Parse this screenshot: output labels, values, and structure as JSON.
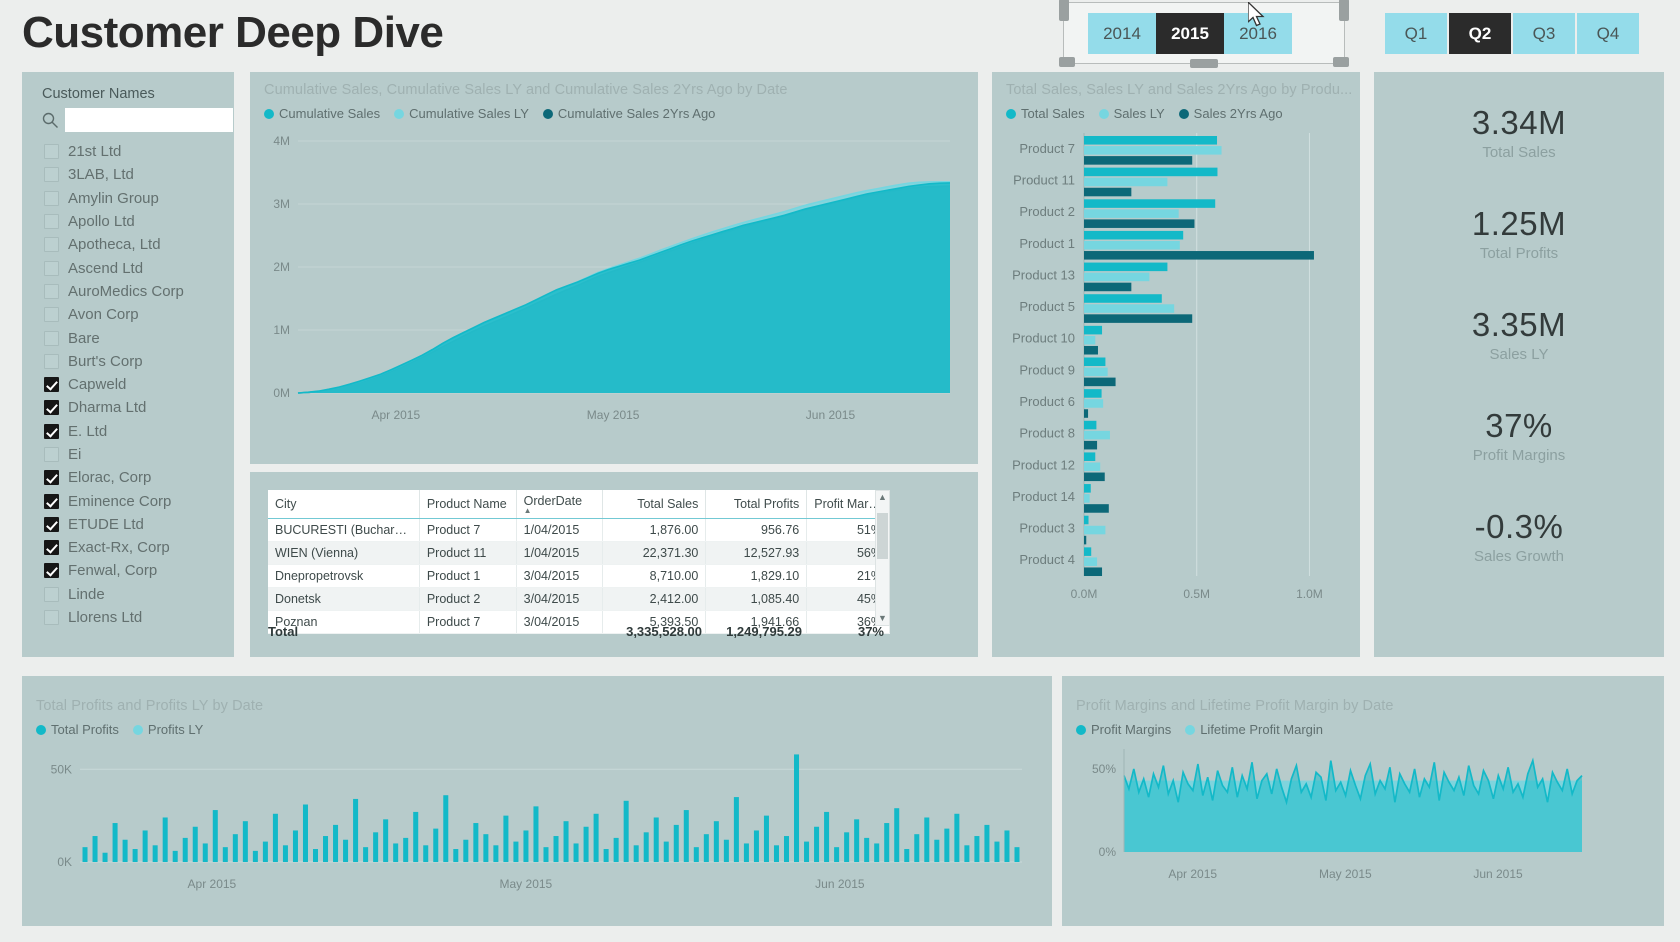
{
  "header": {
    "title": "Customer Deep Dive",
    "year_slicer": {
      "name": "year-slicer",
      "options": [
        "2014",
        "2015",
        "2016"
      ],
      "selected": "2015"
    },
    "quarter_slicer": {
      "name": "quarter-slicer",
      "options": [
        "Q1",
        "Q2",
        "Q3",
        "Q4"
      ],
      "selected": "Q2"
    }
  },
  "slicer": {
    "heading": "Customer Names",
    "search_placeholder": "",
    "search_value": "",
    "search_icon": "search-icon",
    "items": [
      {
        "label": "21st Ltd",
        "checked": false
      },
      {
        "label": "3LAB, Ltd",
        "checked": false
      },
      {
        "label": "Amylin Group",
        "checked": false
      },
      {
        "label": "Apollo Ltd",
        "checked": false
      },
      {
        "label": "Apotheca, Ltd",
        "checked": false
      },
      {
        "label": "Ascend Ltd",
        "checked": false
      },
      {
        "label": "AuroMedics Corp",
        "checked": false
      },
      {
        "label": "Avon Corp",
        "checked": false
      },
      {
        "label": "Bare",
        "checked": false
      },
      {
        "label": "Burt's Corp",
        "checked": false
      },
      {
        "label": "Capweld",
        "checked": true
      },
      {
        "label": "Dharma Ltd",
        "checked": true
      },
      {
        "label": "E. Ltd",
        "checked": true
      },
      {
        "label": "Ei",
        "checked": false
      },
      {
        "label": "Elorac, Corp",
        "checked": true
      },
      {
        "label": "Eminence Corp",
        "checked": true
      },
      {
        "label": "ETUDE Ltd",
        "checked": true
      },
      {
        "label": "Exact-Rx, Corp",
        "checked": true
      },
      {
        "label": "Fenwal, Corp",
        "checked": true
      },
      {
        "label": "Linde",
        "checked": false
      },
      {
        "label": "Llorens Ltd",
        "checked": false
      }
    ]
  },
  "kpis": [
    {
      "value": "3.34M",
      "label": "Total Sales"
    },
    {
      "value": "1.25M",
      "label": "Total Profits"
    },
    {
      "value": "3.35M",
      "label": "Sales LY"
    },
    {
      "value": "37%",
      "label": "Profit Margins"
    },
    {
      "value": "-0.3%",
      "label": "Sales Growth"
    }
  ],
  "table": {
    "columns": [
      "City",
      "Product Name",
      "OrderDate",
      "Total Sales",
      "Total Profits",
      "Profit Margins"
    ],
    "sorted_column": "OrderDate",
    "sort_direction": "asc",
    "rows": [
      [
        "BUCURESTI (Bucharest)",
        "Product 7",
        "1/04/2015",
        "1,876.00",
        "956.76",
        "51%"
      ],
      [
        "WIEN (Vienna)",
        "Product 11",
        "1/04/2015",
        "22,371.30",
        "12,527.93",
        "56%"
      ],
      [
        "Dnepropetrovsk",
        "Product 1",
        "3/04/2015",
        "8,710.00",
        "1,829.10",
        "21%"
      ],
      [
        "Donetsk",
        "Product 2",
        "3/04/2015",
        "2,412.00",
        "1,085.40",
        "45%"
      ],
      [
        "Poznan",
        "Product 7",
        "3/04/2015",
        "5,393.50",
        "1,941.66",
        "36%"
      ]
    ],
    "total_row": {
      "label": "Total",
      "total_sales": "3,335,528.00",
      "total_profits": "1,249,795.29",
      "profit_margins": "37%"
    }
  },
  "colors": {
    "series_primary": "#13b9c8",
    "series_ly": "#76d6e0",
    "series_2yrs": "#0c6878",
    "panel_bg": "#b7cbcb",
    "page_bg": "#eceeed",
    "chip": "#94dcea",
    "chip_selected": "#2b2b2b"
  },
  "chart_data": [
    {
      "name": "cumulative-sales-area-chart",
      "type": "area",
      "title": "Cumulative Sales, Cumulative Sales LY and Cumulative Sales 2Yrs Ago by Date",
      "xlabel": "",
      "ylabel": "",
      "ylim": [
        0,
        4000000
      ],
      "ytick_labels": [
        "0M",
        "1M",
        "2M",
        "3M",
        "4M"
      ],
      "ytick_values": [
        0,
        1000000,
        2000000,
        3000000,
        4000000
      ],
      "xtick_labels": [
        "Apr 2015",
        "May 2015",
        "Jun 2015"
      ],
      "grid": true,
      "legend": [
        "Cumulative Sales",
        "Cumulative Sales LY",
        "Cumulative Sales 2Yrs Ago"
      ],
      "legend_position": "top",
      "x": [
        0,
        1,
        2,
        3,
        4,
        5,
        6,
        7,
        8,
        9,
        10,
        11,
        12,
        13,
        14,
        15,
        16,
        17,
        18,
        19,
        20,
        21,
        22,
        23,
        24,
        25,
        26,
        27,
        28,
        29,
        30,
        31,
        32,
        33,
        34,
        35,
        36,
        37,
        38,
        39,
        40,
        41,
        42,
        43,
        44,
        45,
        46,
        47,
        48,
        49,
        50,
        51,
        52,
        53,
        54,
        55,
        56,
        57,
        58,
        59,
        60,
        61,
        62,
        63
      ],
      "series": [
        {
          "name": "Cumulative Sales",
          "color": "#13b9c8",
          "values": [
            0,
            12000,
            30000,
            60000,
            95000,
            140000,
            190000,
            245000,
            300000,
            370000,
            445000,
            520000,
            600000,
            690000,
            790000,
            880000,
            960000,
            1040000,
            1120000,
            1190000,
            1260000,
            1330000,
            1400000,
            1480000,
            1560000,
            1640000,
            1700000,
            1760000,
            1830000,
            1900000,
            1960000,
            2010000,
            2060000,
            2110000,
            2170000,
            2230000,
            2290000,
            2350000,
            2410000,
            2460000,
            2510000,
            2560000,
            2610000,
            2660000,
            2700000,
            2740000,
            2780000,
            2820000,
            2870000,
            2920000,
            2960000,
            3000000,
            3040000,
            3080000,
            3120000,
            3160000,
            3190000,
            3220000,
            3250000,
            3280000,
            3300000,
            3320000,
            3330000,
            3335528
          ]
        },
        {
          "name": "Cumulative Sales LY",
          "color": "#76d6e0",
          "values": [
            0,
            10000,
            28000,
            55000,
            90000,
            135000,
            180000,
            235000,
            290000,
            360000,
            430000,
            510000,
            590000,
            680000,
            770000,
            860000,
            950000,
            1030000,
            1110000,
            1180000,
            1250000,
            1320000,
            1395000,
            1475000,
            1555000,
            1630000,
            1700000,
            1765000,
            1840000,
            1915000,
            1975000,
            2030000,
            2085000,
            2140000,
            2200000,
            2265000,
            2325000,
            2385000,
            2445000,
            2500000,
            2555000,
            2605000,
            2655000,
            2705000,
            2750000,
            2790000,
            2835000,
            2880000,
            2930000,
            2980000,
            3020000,
            3060000,
            3100000,
            3140000,
            3180000,
            3215000,
            3245000,
            3275000,
            3305000,
            3330000,
            3345000,
            3350000,
            3352000,
            3353000
          ]
        },
        {
          "name": "Cumulative Sales 2Yrs Ago",
          "color": "#0c6878",
          "values": [
            0,
            9000,
            25000,
            52000,
            86000,
            128000,
            172000,
            222000,
            278000,
            345000,
            412000,
            488000,
            566000,
            650000,
            735000,
            820000,
            905000,
            985000,
            1060000,
            1130000,
            1200000,
            1270000,
            1345000,
            1420000,
            1495000,
            1570000,
            1640000,
            1705000,
            1780000,
            1850000,
            1910000,
            1965000,
            2020000,
            2075000,
            2135000,
            2195000,
            2255000,
            2315000,
            2375000,
            2430000,
            2485000,
            2535000,
            2585000,
            2635000,
            2680000,
            2720000,
            2765000,
            2810000,
            2860000,
            2905000,
            2945000,
            2985000,
            3025000,
            3065000,
            3100000,
            3135000,
            3165000,
            3195000,
            3225000,
            3250000,
            3265000,
            3275000,
            3280000,
            3285000
          ]
        }
      ]
    },
    {
      "name": "sales-by-product-bar-chart",
      "type": "bar",
      "title": "Total Sales, Sales LY and Sales 2Yrs Ago by Produ...",
      "orientation": "horizontal",
      "categories": [
        "Product 7",
        "Product 11",
        "Product 2",
        "Product 1",
        "Product 13",
        "Product 5",
        "Product 10",
        "Product 9",
        "Product 6",
        "Product 8",
        "Product 12",
        "Product 14",
        "Product 3",
        "Product 4"
      ],
      "xtick_labels": [
        "0.0M",
        "0.5M",
        "1.0M"
      ],
      "xtick_values": [
        0,
        500000,
        1000000
      ],
      "xlim": [
        0,
        1100000
      ],
      "grid": true,
      "legend": [
        "Total Sales",
        "Sales LY",
        "Sales 2Yrs Ago"
      ],
      "legend_position": "top",
      "series": [
        {
          "name": "Total Sales",
          "color": "#13b9c8",
          "values": [
            590000,
            592000,
            582000,
            440000,
            370000,
            345000,
            80000,
            95000,
            78000,
            55000,
            50000,
            30000,
            20000,
            32000
          ]
        },
        {
          "name": "Sales LY",
          "color": "#76d6e0",
          "values": [
            610000,
            370000,
            420000,
            425000,
            290000,
            400000,
            50000,
            105000,
            85000,
            115000,
            72000,
            25000,
            95000,
            58000
          ]
        },
        {
          "name": "Sales 2Yrs Ago",
          "color": "#0c6878",
          "values": [
            480000,
            210000,
            490000,
            1020000,
            210000,
            480000,
            62000,
            140000,
            18000,
            58000,
            92000,
            110000,
            10000,
            80000
          ]
        }
      ]
    },
    {
      "name": "total-profits-bar-chart",
      "type": "bar",
      "title": "Total Profits and Profits LY by Date",
      "orientation": "vertical",
      "ytick_labels": [
        "0K",
        "50K"
      ],
      "ytick_values": [
        0,
        50000
      ],
      "ylim": [
        0,
        62000
      ],
      "xtick_labels": [
        "Apr 2015",
        "May 2015",
        "Jun 2015"
      ],
      "grid": true,
      "legend": [
        "Total Profits",
        "Profits LY"
      ],
      "legend_position": "top",
      "series": [
        {
          "name": "Total Profits",
          "color": "#13b9c8",
          "values": [
            8000,
            14000,
            5000,
            21000,
            12000,
            7000,
            17000,
            9000,
            24000,
            6000,
            13000,
            19000,
            10000,
            28000,
            8000,
            15000,
            22000,
            6000,
            11000,
            26000,
            9000,
            17000,
            31000,
            7000,
            14000,
            20000,
            12000,
            34000,
            8000,
            16000,
            23000,
            10000,
            13000,
            27000,
            9000,
            18000,
            36000,
            7000,
            12000,
            21000,
            15000,
            9000,
            25000,
            11000,
            17000,
            30000,
            8000,
            14000,
            22000,
            10000,
            19000,
            26000,
            7000,
            13000,
            33000,
            9000,
            16000,
            24000,
            11000,
            20000,
            28000,
            8000,
            15000,
            22000,
            12000,
            35000,
            10000,
            17000,
            25000,
            9000,
            14000,
            58000,
            11000,
            19000,
            27000,
            8000,
            16000,
            23000,
            13000,
            10000,
            21000,
            29000,
            7000,
            15000,
            24000,
            12000,
            18000,
            26000,
            9000,
            14000,
            20000,
            11000,
            17000,
            8000
          ]
        }
      ]
    },
    {
      "name": "profit-margins-area-chart",
      "type": "area",
      "title": "Profit Margins and Lifetime Profit Margin by Date",
      "ytick_labels": [
        "0%",
        "50%"
      ],
      "ytick_values": [
        0,
        50
      ],
      "ylim": [
        0,
        62
      ],
      "xtick_labels": [
        "Apr 2015",
        "May 2015",
        "Jun 2015"
      ],
      "grid": false,
      "legend": [
        "Profit Margins",
        "Lifetime Profit Margin"
      ],
      "legend_position": "top",
      "series": [
        {
          "name": "Profit Margins",
          "color": "#13b9c8",
          "values": [
            46,
            38,
            50,
            36,
            44,
            33,
            47,
            39,
            52,
            35,
            43,
            30,
            48,
            41,
            37,
            53,
            34,
            45,
            31,
            49,
            40,
            36,
            51,
            33,
            46,
            38,
            54,
            32,
            43,
            47,
            35,
            50,
            39,
            30,
            44,
            52,
            36,
            41,
            33,
            48,
            45,
            31,
            55,
            37,
            42,
            34,
            49,
            40,
            32,
            46,
            53,
            35,
            43,
            38,
            51,
            30,
            47,
            41,
            36,
            50,
            33,
            44,
            39,
            54,
            31,
            48,
            42,
            37,
            45,
            34,
            52,
            40,
            35,
            49,
            43,
            32,
            46,
            38,
            51,
            36,
            41,
            33,
            47,
            55,
            39,
            44,
            30,
            48,
            42,
            37,
            50,
            35,
            43,
            46
          ]
        },
        {
          "name": "Lifetime Profit Margin",
          "color": "#76d6e0",
          "constant": 43
        }
      ]
    }
  ]
}
